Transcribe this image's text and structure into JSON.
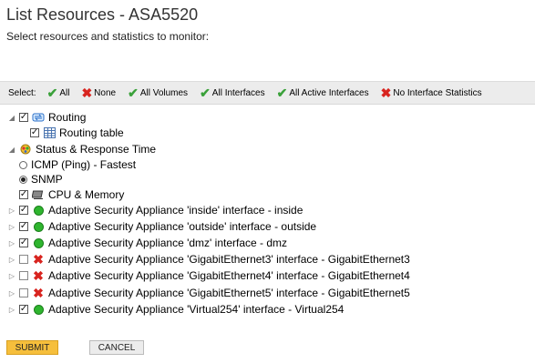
{
  "page": {
    "title": "List Resources - ASA5520",
    "subtitle": "Select resources and statistics to monitor:"
  },
  "select_bar": {
    "label": "Select:",
    "options": [
      {
        "label": "All",
        "icon": "check-icon"
      },
      {
        "label": "None",
        "icon": "x-icon"
      },
      {
        "label": "All Volumes",
        "icon": "check-icon"
      },
      {
        "label": "All Interfaces",
        "icon": "check-icon"
      },
      {
        "label": "All Active Interfaces",
        "icon": "check-icon"
      },
      {
        "label": "No Interface Statistics",
        "icon": "x-icon"
      }
    ]
  },
  "tree": {
    "routing": {
      "label": "Routing",
      "checked": true,
      "icon": "routing-icon"
    },
    "routing_table": {
      "label": "Routing table",
      "checked": true,
      "icon": "table-icon"
    },
    "status": {
      "label": "Status & Response Time",
      "icon": "status-icon"
    },
    "icmp": {
      "label": "ICMP (Ping) - Fastest",
      "selected": false
    },
    "snmp": {
      "label": "SNMP",
      "selected": true
    },
    "cpu": {
      "label": "CPU & Memory",
      "checked": true,
      "icon": "cpu-icon"
    },
    "interfaces": [
      {
        "label": "Adaptive Security Appliance 'inside' interface - inside",
        "checked": true,
        "status": "up"
      },
      {
        "label": "Adaptive Security Appliance 'outside' interface - outside",
        "checked": true,
        "status": "up"
      },
      {
        "label": "Adaptive Security Appliance 'dmz' interface - dmz",
        "checked": true,
        "status": "up"
      },
      {
        "label": "Adaptive Security Appliance 'GigabitEthernet3' interface - GigabitEthernet3",
        "checked": false,
        "status": "down"
      },
      {
        "label": "Adaptive Security Appliance 'GigabitEthernet4' interface - GigabitEthernet4",
        "checked": false,
        "status": "down"
      },
      {
        "label": "Adaptive Security Appliance 'GigabitEthernet5' interface - GigabitEthernet5",
        "checked": false,
        "status": "down"
      },
      {
        "label": "Adaptive Security Appliance 'Virtual254' interface - Virtual254",
        "checked": true,
        "status": "up"
      }
    ]
  },
  "buttons": {
    "submit": "SUBMIT",
    "cancel": "CANCEL"
  },
  "colors": {
    "submit_bg": "#f6bf3c",
    "status_up": "#2fb52f",
    "status_down": "#d8241f",
    "check": "#3aa13a"
  }
}
